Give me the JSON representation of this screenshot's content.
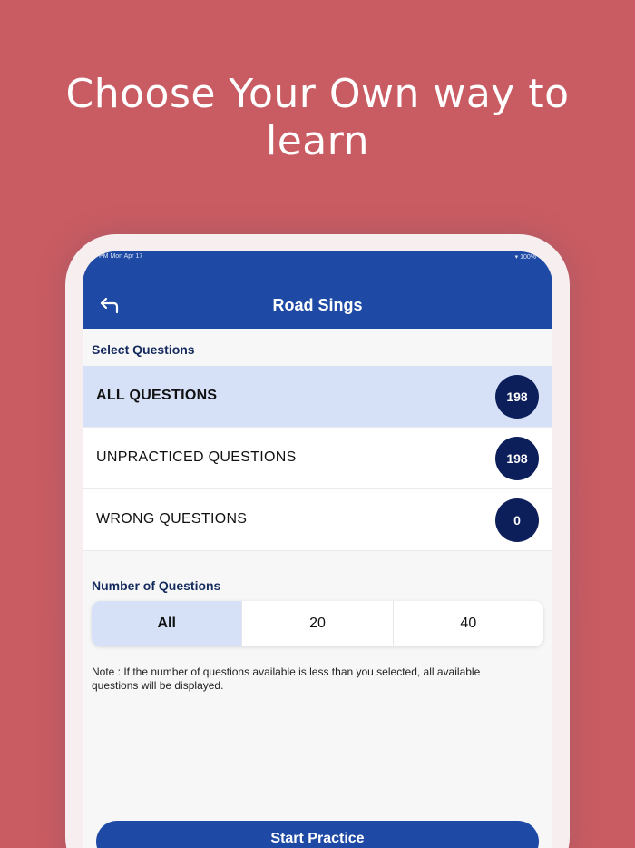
{
  "headline": {
    "line1": "Choose Your Own way to",
    "line2": "learn"
  },
  "status_bar": {
    "time": "PM  Mon Apr 17",
    "battery": "100%"
  },
  "app_bar": {
    "title": "Road Sings",
    "back_icon": "back-arrow-icon"
  },
  "select_questions": {
    "label": "Select Questions",
    "items": [
      {
        "label": "ALL QUESTIONS",
        "count": "198",
        "active": true
      },
      {
        "label": "UNPRACTICED QUESTIONS",
        "count": "198",
        "active": false
      },
      {
        "label": "WRONG QUESTIONS",
        "count": "0",
        "active": false
      }
    ]
  },
  "number_of_questions": {
    "label": "Number of Questions",
    "options": [
      "All",
      "20",
      "40"
    ],
    "selected": "All"
  },
  "note": "Note : If the number of questions available is less than you selected, all available questions will be displayed.",
  "start_button": "Start Practice",
  "colors": {
    "background": "#c95c62",
    "app_bar": "#1e4aa5",
    "active_row": "#d6e1f8",
    "badge": "#0d1f5a"
  }
}
